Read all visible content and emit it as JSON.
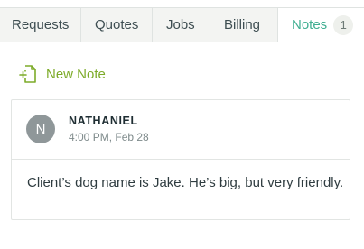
{
  "tabs": [
    {
      "label": "Requests"
    },
    {
      "label": "Quotes"
    },
    {
      "label": "Jobs"
    },
    {
      "label": "Billing"
    },
    {
      "label": "Notes",
      "count": "1",
      "active": true
    }
  ],
  "actions": {
    "new_note_label": "New Note",
    "new_note_icon": "add-document-icon"
  },
  "note": {
    "avatar_initial": "N",
    "author": "NATHANIEL",
    "timestamp": "4:00 PM, Feb 28",
    "body": "Client’s dog name is Jake. He’s big, but very friendly."
  },
  "colors": {
    "accent_green": "#7dab29",
    "active_tab_teal": "#3fae91",
    "avatar_gray": "#8f9799"
  }
}
